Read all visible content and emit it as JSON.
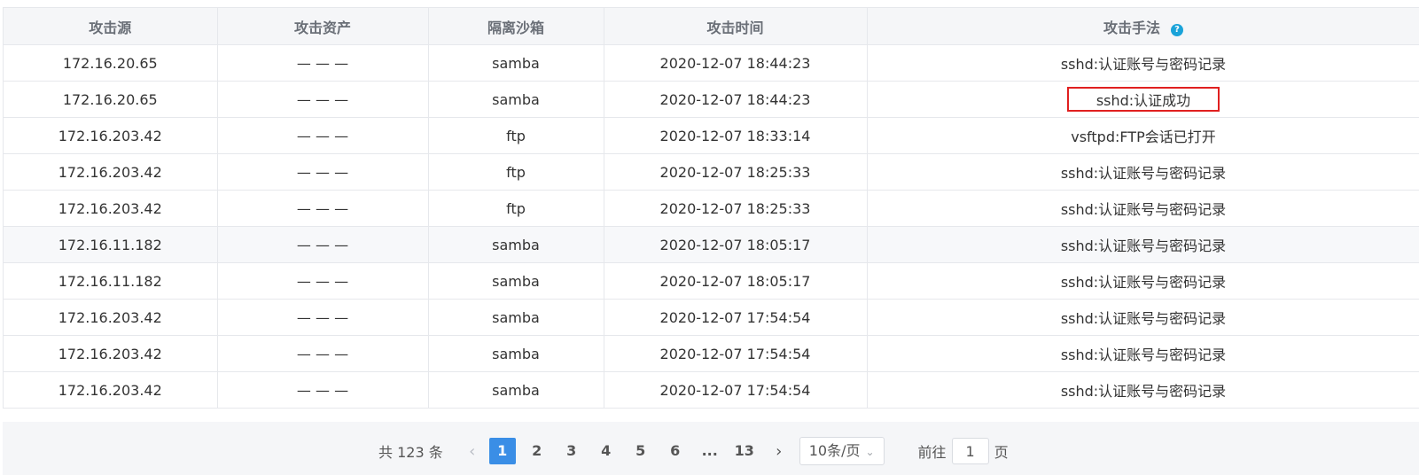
{
  "table": {
    "headers": [
      "攻击源",
      "攻击资产",
      "隔离沙箱",
      "攻击时间",
      "攻击手法"
    ],
    "help_icon": "?",
    "rows": [
      {
        "source": "172.16.20.65",
        "asset": "— — —",
        "sandbox": "samba",
        "time": "2020-12-07 18:44:23",
        "method": "sshd:认证账号与密码记录"
      },
      {
        "source": "172.16.20.65",
        "asset": "— — —",
        "sandbox": "samba",
        "time": "2020-12-07 18:44:23",
        "method": "sshd:认证成功"
      },
      {
        "source": "172.16.203.42",
        "asset": "— — —",
        "sandbox": "ftp",
        "time": "2020-12-07 18:33:14",
        "method": "vsftpd:FTP会话已打开"
      },
      {
        "source": "172.16.203.42",
        "asset": "— — —",
        "sandbox": "ftp",
        "time": "2020-12-07 18:25:33",
        "method": "sshd:认证账号与密码记录"
      },
      {
        "source": "172.16.203.42",
        "asset": "— — —",
        "sandbox": "ftp",
        "time": "2020-12-07 18:25:33",
        "method": "sshd:认证账号与密码记录"
      },
      {
        "source": "172.16.11.182",
        "asset": "— — —",
        "sandbox": "samba",
        "time": "2020-12-07 18:05:17",
        "method": "sshd:认证账号与密码记录"
      },
      {
        "source": "172.16.11.182",
        "asset": "— — —",
        "sandbox": "samba",
        "time": "2020-12-07 18:05:17",
        "method": "sshd:认证账号与密码记录"
      },
      {
        "source": "172.16.203.42",
        "asset": "— — —",
        "sandbox": "samba",
        "time": "2020-12-07 17:54:54",
        "method": "sshd:认证账号与密码记录"
      },
      {
        "source": "172.16.203.42",
        "asset": "— — —",
        "sandbox": "samba",
        "time": "2020-12-07 17:54:54",
        "method": "sshd:认证账号与密码记录"
      },
      {
        "source": "172.16.203.42",
        "asset": "— — —",
        "sandbox": "samba",
        "time": "2020-12-07 17:54:54",
        "method": "sshd:认证账号与密码记录"
      }
    ]
  },
  "pagination": {
    "total_text": "共 123 条",
    "prev": "‹",
    "next": "›",
    "pages": [
      "1",
      "2",
      "3",
      "4",
      "5",
      "6",
      "...",
      "13"
    ],
    "current_page": "1",
    "page_size": "10条/页",
    "goto_prefix": "前往",
    "goto_value": "1",
    "goto_suffix": "页"
  },
  "colors": {
    "header_bg": "#f5f6f8",
    "border": "#e6e8ec",
    "active_page": "#3a8ee6",
    "highlight_box": "#e02020",
    "help_icon": "#1aa3d9"
  }
}
